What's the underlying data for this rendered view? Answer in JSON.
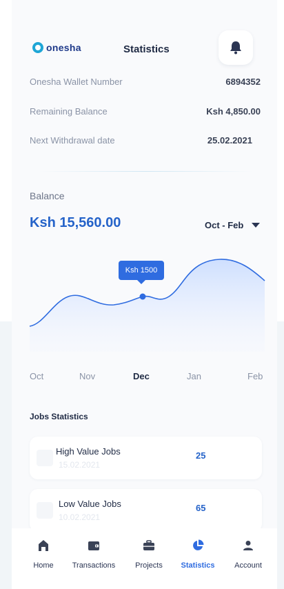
{
  "header": {
    "logo_text": "onesha",
    "title": "Statistics",
    "bell_icon": "bell-icon"
  },
  "info": [
    {
      "label": "Onesha Wallet Number",
      "value": "6894352"
    },
    {
      "label": "Remaining Balance",
      "value": "Ksh 4,850.00"
    },
    {
      "label": "Next Withdrawal date",
      "value": "25.02.2021"
    }
  ],
  "balance": {
    "label": "Balance",
    "amount": "Ksh 15,560.00",
    "range": "Oct - Feb"
  },
  "chart_data": {
    "type": "area",
    "categories": [
      "Oct",
      "Nov",
      "Dec",
      "Jan",
      "Feb"
    ],
    "highlight": {
      "label": "Ksh 1500",
      "category": "Dec"
    },
    "active_category": "Dec"
  },
  "jobs": {
    "title": "Jobs Statistics",
    "items": [
      {
        "name": "High Value Jobs",
        "date": "15.02.2021",
        "count": "25"
      },
      {
        "name": "Low Value Jobs",
        "date": "10.02.2021",
        "count": "65"
      }
    ]
  },
  "tabs": [
    {
      "label": "Home",
      "icon": "home-icon",
      "active": false
    },
    {
      "label": "Transactions",
      "icon": "wallet-icon",
      "active": false
    },
    {
      "label": "Projects",
      "icon": "briefcase-icon",
      "active": false
    },
    {
      "label": "Statistics",
      "icon": "pie-chart-icon",
      "active": true
    },
    {
      "label": "Account",
      "icon": "user-icon",
      "active": false
    }
  ],
  "colors": {
    "accent": "#2f6ce0",
    "logo": "#1fa6d6"
  }
}
